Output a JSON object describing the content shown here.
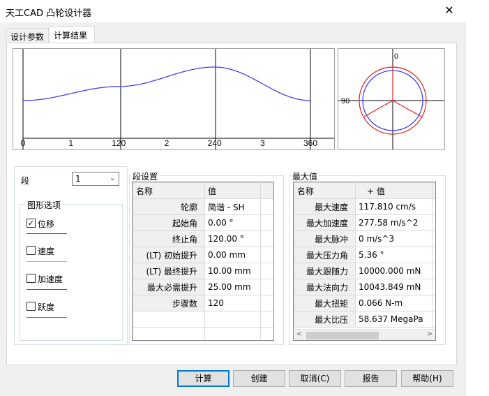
{
  "window": {
    "title": "天工CAD 凸轮设计器",
    "close_label": "✕"
  },
  "tabs": [
    {
      "label": "设计参数"
    },
    {
      "label": "计算结果"
    }
  ],
  "motion_chart": {
    "x_ticks": [
      "0",
      "1",
      "120",
      "2",
      "240",
      "3",
      "360"
    ],
    "curve_color": "#3232ff"
  },
  "profile_chart": {
    "label_0": "0",
    "label_90": "90",
    "base_circle_color": "#3232ff",
    "profile_color": "#e02020"
  },
  "segment": {
    "label": "段",
    "value": "1"
  },
  "graph_options": {
    "title": "图形选项",
    "items": [
      {
        "label": "位移",
        "checked": true,
        "check_mark": "✓",
        "color": "#3a3aff"
      },
      {
        "label": "速度",
        "checked": false,
        "check_mark": "",
        "color": "#ff7fd0"
      },
      {
        "label": "加速度",
        "checked": false,
        "check_mark": "",
        "color": "#e02020"
      },
      {
        "label": "跃度",
        "checked": false,
        "check_mark": "",
        "color": "#2ca02c"
      }
    ]
  },
  "segment_settings": {
    "title": "段设置",
    "headers": [
      "名称",
      "值"
    ],
    "rows": [
      {
        "name": "轮廓",
        "value": "简谐 - SH"
      },
      {
        "name": "起始角",
        "value": "0.00 °"
      },
      {
        "name": "终止角",
        "value": "120.00 °"
      },
      {
        "name": "(LT) 初始提升",
        "value": "0.00 mm"
      },
      {
        "name": "(LT) 最终提升",
        "value": "10.00 mm"
      },
      {
        "name": "最大必需提升",
        "value": "25.00 mm"
      },
      {
        "name": "步骤数",
        "value": "120"
      }
    ]
  },
  "max_values": {
    "title": "最大值",
    "headers": [
      "名称",
      "+ 值"
    ],
    "rows": [
      {
        "name": "最大速度",
        "value": "117.810 cm/s",
        "extra": "("
      },
      {
        "name": "最大加速度",
        "value": "277.58 m/s^2",
        "extra": "-"
      },
      {
        "name": "最大脉冲",
        "value": "0 m/s^3",
        "extra": "-"
      },
      {
        "name": "最大压力角",
        "value": "5.36 °",
        "extra": "("
      },
      {
        "name": "最大跟随力",
        "value": "10000.000 mN",
        "extra": "-"
      },
      {
        "name": "最大法向力",
        "value": "10043.849 mN",
        "extra": "-"
      },
      {
        "name": "最大扭矩",
        "value": "0.066 N-m",
        "extra": ""
      },
      {
        "name": "最大比压",
        "value": "58.637 MegaPa",
        "extra": ""
      }
    ],
    "scroll_left": "<",
    "scroll_right": ">"
  },
  "buttons": {
    "calculate": "计算",
    "create": "创建",
    "cancel": "取消(C)",
    "report": "报告",
    "help": "帮助(H)"
  }
}
